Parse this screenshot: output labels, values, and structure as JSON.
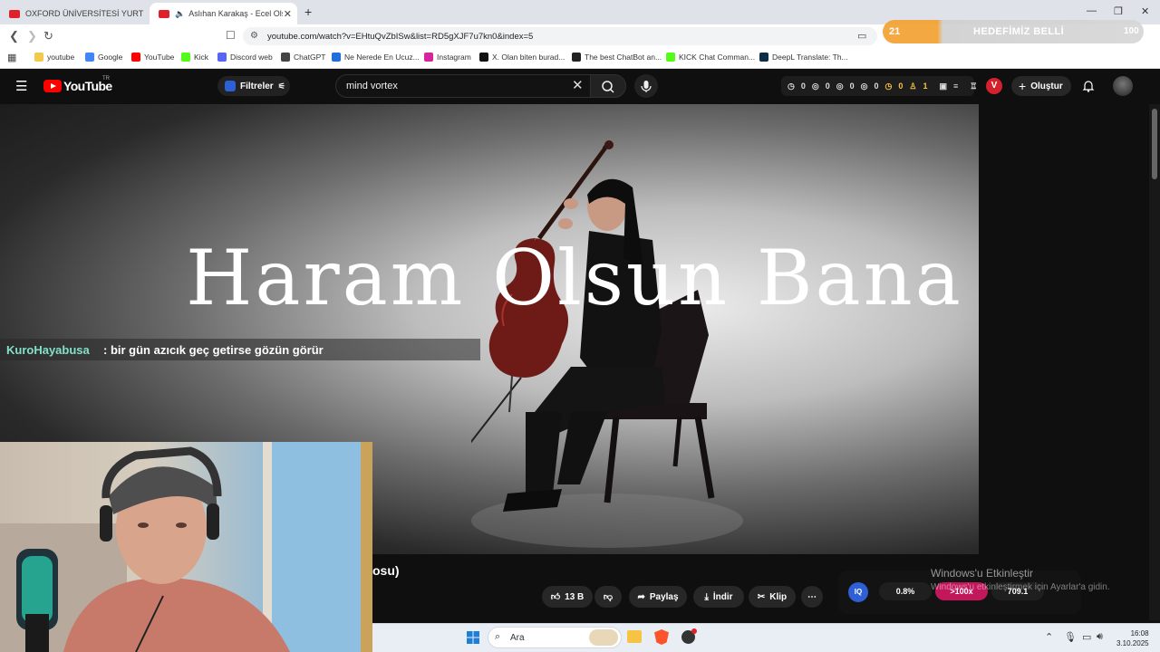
{
  "browser": {
    "tabs": [
      {
        "label": "OXFORD ÜNİVERSİTESİ YURT ODASI",
        "active": false
      },
      {
        "label": "Aslıhan Karakaş - Ecel Olsun Bana",
        "active": true
      }
    ],
    "new_tab": "+",
    "url": "youtube.com/watch?v=EHtuQvZbISw&list=RD5gXJF7u7kn0&index=5",
    "bookmarks": [
      {
        "label": "youtube",
        "color": "#f2c94c"
      },
      {
        "label": "Google",
        "color": "#4285f4"
      },
      {
        "label": "YouTube",
        "color": "#ff0000"
      },
      {
        "label": "Kick",
        "color": "#53fc18"
      },
      {
        "label": "Discord web",
        "color": "#5865f2"
      },
      {
        "label": "ChatGPT",
        "color": "#444444"
      },
      {
        "label": "Ne Nerede En Ucuz...",
        "color": "#1e6fd9"
      },
      {
        "label": "Instagram",
        "color": "#d6249f"
      },
      {
        "label": "X. Olan biten burad...",
        "color": "#111111"
      },
      {
        "label": "The best ChatBot an...",
        "color": "#222222"
      },
      {
        "label": "KICK Chat Comman...",
        "color": "#53fc18"
      },
      {
        "label": "DeepL Translate: Th...",
        "color": "#0f2b46"
      }
    ]
  },
  "goal_overlay": {
    "current": "21",
    "label": "HEDEFİMİZ BELLİ",
    "target": "100",
    "progress": 0.21
  },
  "youtube": {
    "logo": "YouTube",
    "region": "TR",
    "filters_label": "Filtreler",
    "search_value": "mind vortex",
    "stats": [
      "0",
      "0",
      "0",
      "0",
      "0",
      "1"
    ],
    "v_badge": "V",
    "create_label": "Oluştur"
  },
  "video": {
    "title_overlay": "Haram Olsun Bana",
    "title_fragment": "osu)",
    "likes": "13 B",
    "share_label": "Paylaş",
    "download_label": "İndir",
    "clip_label": "Klip",
    "more": "⋯"
  },
  "chat_overlay": {
    "user": "KuroHayabusa",
    "message": ": bir gün azıcık geç getirse gözün görür"
  },
  "extension": {
    "badge": "IQ",
    "values": [
      "0.8%",
      ">100x",
      "709.1"
    ]
  },
  "windows_watermark": {
    "line1": "Windows'u Etkinleştir",
    "line2": "Windows'u etkinleştirmek için Ayarlar'a gidin."
  },
  "taskbar": {
    "search_placeholder": "Ara",
    "time": "16:08",
    "date": "3.10.2025"
  },
  "colors": {
    "accent": "#ff0000",
    "goal": "#f3a131",
    "chat_user": "#83e0c8"
  }
}
